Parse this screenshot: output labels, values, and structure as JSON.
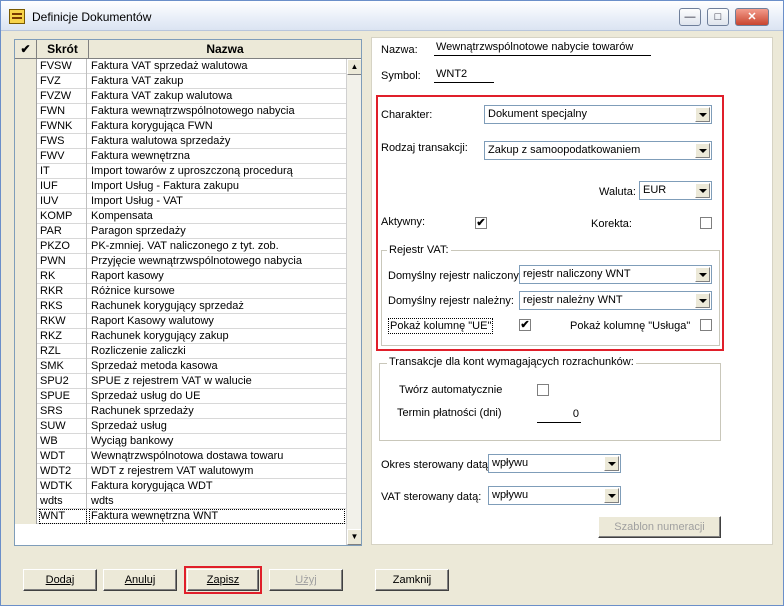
{
  "window": {
    "title": "Definicje Dokumentów",
    "minimize_glyph": "—",
    "maximize_glyph": "□",
    "close_glyph": "✕"
  },
  "grid": {
    "check_header": "✔",
    "col_code": "Skrót",
    "col_name": "Nazwa",
    "rows": [
      {
        "code": "FVSW",
        "name": "Faktura VAT sprzedaż walutowa"
      },
      {
        "code": "FVZ",
        "name": "Faktura VAT zakup"
      },
      {
        "code": "FVZW",
        "name": "Faktura VAT zakup walutowa"
      },
      {
        "code": "FWN",
        "name": "Faktura wewnątrzwspólnotowego nabycia"
      },
      {
        "code": "FWNK",
        "name": "Faktura korygująca FWN"
      },
      {
        "code": "FWS",
        "name": "Faktura walutowa sprzedaży"
      },
      {
        "code": "FWV",
        "name": "Faktura wewnętrzna"
      },
      {
        "code": "IT",
        "name": "Import towarów z uproszczoną procedurą"
      },
      {
        "code": "IUF",
        "name": "Import Usług - Faktura zakupu"
      },
      {
        "code": "IUV",
        "name": "Import Usług - VAT"
      },
      {
        "code": "KOMP",
        "name": "Kompensata"
      },
      {
        "code": "PAR",
        "name": "Paragon sprzedaży"
      },
      {
        "code": "PKZO",
        "name": "PK-zmniej. VAT naliczonego z tyt. zob."
      },
      {
        "code": "PWN",
        "name": "Przyjęcie wewnątrzwspólnotowego nabycia"
      },
      {
        "code": "RK",
        "name": "Raport kasowy"
      },
      {
        "code": "RKR",
        "name": "Różnice kursowe"
      },
      {
        "code": "RKS",
        "name": "Rachunek korygujący sprzedaż"
      },
      {
        "code": "RKW",
        "name": "Raport Kasowy walutowy"
      },
      {
        "code": "RKZ",
        "name": "Rachunek korygujący zakup"
      },
      {
        "code": "RZL",
        "name": "Rozliczenie zaliczki"
      },
      {
        "code": "SMK",
        "name": "Sprzedaż metoda kasowa"
      },
      {
        "code": "SPU2",
        "name": "SPUE z rejestrem VAT w walucie"
      },
      {
        "code": "SPUE",
        "name": "Sprzedaż usług do UE"
      },
      {
        "code": "SRS",
        "name": "Rachunek sprzedaży"
      },
      {
        "code": "SUW",
        "name": "Sprzedaż usług"
      },
      {
        "code": "WB",
        "name": "Wyciąg bankowy"
      },
      {
        "code": "WDT",
        "name": "Wewnątrzwspólnotowa dostawa towaru"
      },
      {
        "code": "WDT2",
        "name": "WDT z rejestrem VAT walutowym"
      },
      {
        "code": "WDTK",
        "name": "Faktura korygująca WDT"
      },
      {
        "code": "wdts",
        "name": "wdts"
      },
      {
        "code": "WNT",
        "name": "Faktura wewnętrzna WNT"
      }
    ]
  },
  "form": {
    "name_label": "Nazwa:",
    "name_value": "Wewnątrzwspólnotowe nabycie towarów",
    "symbol_label": "Symbol:",
    "symbol_value": "WNT2",
    "charakter_label": "Charakter:",
    "charakter_value": "Dokument specjalny",
    "rodzaj_label": "Rodzaj transakcji:",
    "rodzaj_value": "Zakup z samoopodatkowaniem",
    "waluta_label": "Waluta:",
    "waluta_value": "EUR",
    "aktywny_label": "Aktywny:",
    "aktywny_checked": "✔",
    "korekta_label": "Korekta:",
    "rejestr_group": "Rejestr VAT:",
    "rej_naliczony_label": "Domyślny rejestr naliczony:",
    "rej_naliczony_value": "rejestr naliczony WNT",
    "rej_nalezny_label": "Domyślny rejestr należny:",
    "rej_nalezny_value": "rejestr należny WNT",
    "pokaz_ue_label": "Pokaż kolumnę \"UE\"",
    "pokaz_ue_checked": "✔",
    "pokaz_usluga_label": "Pokaż kolumnę \"Usługa\"",
    "transakcje_group": "Transakcje dla kont wymagających rozrachunków:",
    "tworz_label": "Twórz automatycznie",
    "termin_label": "Termin płatności (dni)",
    "termin_value": "0",
    "okres_label": "Okres sterowany datą:",
    "okres_value": "wpływu",
    "vat_label": "VAT sterowany datą:",
    "vat_value": "wpływu",
    "szablon_label": "Szablon numeracji"
  },
  "buttons": {
    "dodaj": "Dodaj",
    "anuluj": "Anuluj",
    "zapisz": "Zapisz",
    "uzyj": "Użyj",
    "zamknij": "Zamknij"
  }
}
